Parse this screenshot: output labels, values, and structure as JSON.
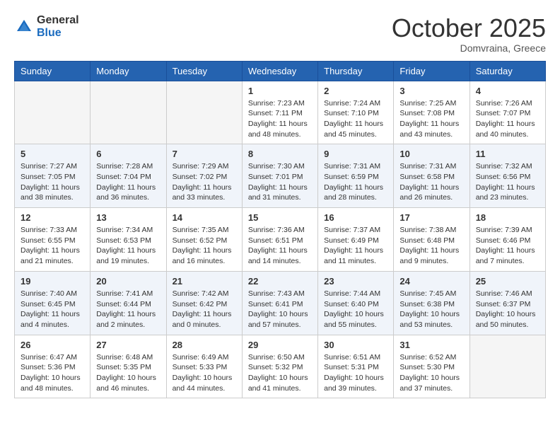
{
  "logo": {
    "general": "General",
    "blue": "Blue"
  },
  "header": {
    "month": "October 2025",
    "location": "Domvraina, Greece"
  },
  "weekdays": [
    "Sunday",
    "Monday",
    "Tuesday",
    "Wednesday",
    "Thursday",
    "Friday",
    "Saturday"
  ],
  "weeks": [
    {
      "shaded": false,
      "days": [
        {
          "num": "",
          "info": ""
        },
        {
          "num": "",
          "info": ""
        },
        {
          "num": "",
          "info": ""
        },
        {
          "num": "1",
          "info": "Sunrise: 7:23 AM\nSunset: 7:11 PM\nDaylight: 11 hours\nand 48 minutes."
        },
        {
          "num": "2",
          "info": "Sunrise: 7:24 AM\nSunset: 7:10 PM\nDaylight: 11 hours\nand 45 minutes."
        },
        {
          "num": "3",
          "info": "Sunrise: 7:25 AM\nSunset: 7:08 PM\nDaylight: 11 hours\nand 43 minutes."
        },
        {
          "num": "4",
          "info": "Sunrise: 7:26 AM\nSunset: 7:07 PM\nDaylight: 11 hours\nand 40 minutes."
        }
      ]
    },
    {
      "shaded": true,
      "days": [
        {
          "num": "5",
          "info": "Sunrise: 7:27 AM\nSunset: 7:05 PM\nDaylight: 11 hours\nand 38 minutes."
        },
        {
          "num": "6",
          "info": "Sunrise: 7:28 AM\nSunset: 7:04 PM\nDaylight: 11 hours\nand 36 minutes."
        },
        {
          "num": "7",
          "info": "Sunrise: 7:29 AM\nSunset: 7:02 PM\nDaylight: 11 hours\nand 33 minutes."
        },
        {
          "num": "8",
          "info": "Sunrise: 7:30 AM\nSunset: 7:01 PM\nDaylight: 11 hours\nand 31 minutes."
        },
        {
          "num": "9",
          "info": "Sunrise: 7:31 AM\nSunset: 6:59 PM\nDaylight: 11 hours\nand 28 minutes."
        },
        {
          "num": "10",
          "info": "Sunrise: 7:31 AM\nSunset: 6:58 PM\nDaylight: 11 hours\nand 26 minutes."
        },
        {
          "num": "11",
          "info": "Sunrise: 7:32 AM\nSunset: 6:56 PM\nDaylight: 11 hours\nand 23 minutes."
        }
      ]
    },
    {
      "shaded": false,
      "days": [
        {
          "num": "12",
          "info": "Sunrise: 7:33 AM\nSunset: 6:55 PM\nDaylight: 11 hours\nand 21 minutes."
        },
        {
          "num": "13",
          "info": "Sunrise: 7:34 AM\nSunset: 6:53 PM\nDaylight: 11 hours\nand 19 minutes."
        },
        {
          "num": "14",
          "info": "Sunrise: 7:35 AM\nSunset: 6:52 PM\nDaylight: 11 hours\nand 16 minutes."
        },
        {
          "num": "15",
          "info": "Sunrise: 7:36 AM\nSunset: 6:51 PM\nDaylight: 11 hours\nand 14 minutes."
        },
        {
          "num": "16",
          "info": "Sunrise: 7:37 AM\nSunset: 6:49 PM\nDaylight: 11 hours\nand 11 minutes."
        },
        {
          "num": "17",
          "info": "Sunrise: 7:38 AM\nSunset: 6:48 PM\nDaylight: 11 hours\nand 9 minutes."
        },
        {
          "num": "18",
          "info": "Sunrise: 7:39 AM\nSunset: 6:46 PM\nDaylight: 11 hours\nand 7 minutes."
        }
      ]
    },
    {
      "shaded": true,
      "days": [
        {
          "num": "19",
          "info": "Sunrise: 7:40 AM\nSunset: 6:45 PM\nDaylight: 11 hours\nand 4 minutes."
        },
        {
          "num": "20",
          "info": "Sunrise: 7:41 AM\nSunset: 6:44 PM\nDaylight: 11 hours\nand 2 minutes."
        },
        {
          "num": "21",
          "info": "Sunrise: 7:42 AM\nSunset: 6:42 PM\nDaylight: 11 hours\nand 0 minutes."
        },
        {
          "num": "22",
          "info": "Sunrise: 7:43 AM\nSunset: 6:41 PM\nDaylight: 10 hours\nand 57 minutes."
        },
        {
          "num": "23",
          "info": "Sunrise: 7:44 AM\nSunset: 6:40 PM\nDaylight: 10 hours\nand 55 minutes."
        },
        {
          "num": "24",
          "info": "Sunrise: 7:45 AM\nSunset: 6:38 PM\nDaylight: 10 hours\nand 53 minutes."
        },
        {
          "num": "25",
          "info": "Sunrise: 7:46 AM\nSunset: 6:37 PM\nDaylight: 10 hours\nand 50 minutes."
        }
      ]
    },
    {
      "shaded": false,
      "days": [
        {
          "num": "26",
          "info": "Sunrise: 6:47 AM\nSunset: 5:36 PM\nDaylight: 10 hours\nand 48 minutes."
        },
        {
          "num": "27",
          "info": "Sunrise: 6:48 AM\nSunset: 5:35 PM\nDaylight: 10 hours\nand 46 minutes."
        },
        {
          "num": "28",
          "info": "Sunrise: 6:49 AM\nSunset: 5:33 PM\nDaylight: 10 hours\nand 44 minutes."
        },
        {
          "num": "29",
          "info": "Sunrise: 6:50 AM\nSunset: 5:32 PM\nDaylight: 10 hours\nand 41 minutes."
        },
        {
          "num": "30",
          "info": "Sunrise: 6:51 AM\nSunset: 5:31 PM\nDaylight: 10 hours\nand 39 minutes."
        },
        {
          "num": "31",
          "info": "Sunrise: 6:52 AM\nSunset: 5:30 PM\nDaylight: 10 hours\nand 37 minutes."
        },
        {
          "num": "",
          "info": ""
        }
      ]
    }
  ]
}
